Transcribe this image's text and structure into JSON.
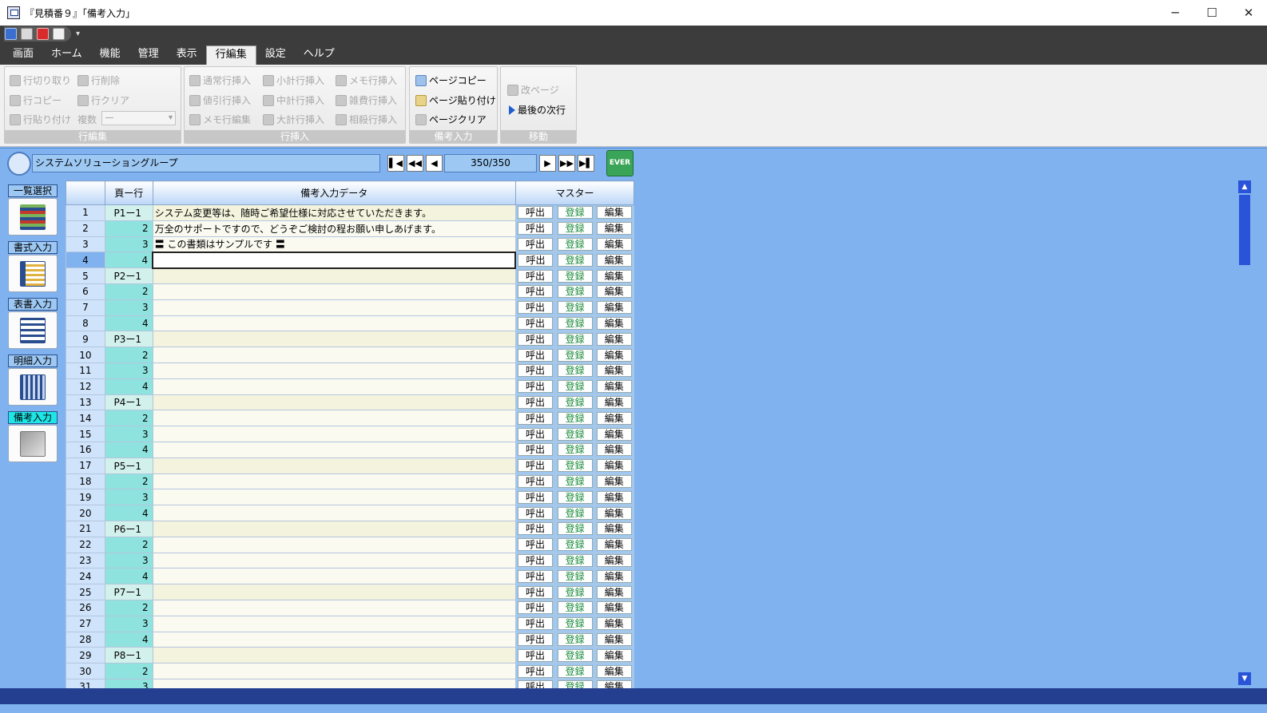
{
  "window": {
    "title": "『見積番９』「備考入力」",
    "minimize": "─",
    "maximize": "☐",
    "close": "✕"
  },
  "qat_more": "▾",
  "menu": [
    "画面",
    "ホーム",
    "機能",
    "管理",
    "表示",
    "行編集",
    "設定",
    "ヘルプ"
  ],
  "menu_active": "行編集",
  "ribbon": {
    "edit": {
      "label": "行編集",
      "cut": "行切り取り",
      "delete": "行削除",
      "copy": "行コピー",
      "clear": "行クリア",
      "paste": "行貼り付け",
      "multi": "複数",
      "multi_value": "ー"
    },
    "insert": {
      "label": "行挿入",
      "normal": "通常行挿入",
      "subtotal": "小計行挿入",
      "memo_insert": "メモ行挿入",
      "discount": "値引行挿入",
      "midtotal": "中計行挿入",
      "misc": "雑費行挿入",
      "memo_edit": "メモ行編集",
      "grandtotal": "大計行挿入",
      "offset": "相殺行挿入"
    },
    "remarks": {
      "label": "備考入力",
      "page_copy": "ページコピー",
      "page_paste": "ページ貼り付け",
      "page_clear": "ページクリア"
    },
    "move": {
      "label": "移動",
      "break": "改ページ",
      "last": "最後の次行"
    }
  },
  "navbar": {
    "group_name": "システムソリューショングループ",
    "first": "▌◀",
    "prev_fast": "◀◀",
    "prev": "◀",
    "page": "350/350",
    "next": "▶",
    "next_fast": "▶▶",
    "last": "▶▌",
    "ever": "EVER"
  },
  "sidebar": [
    "一覧選択",
    "書式入力",
    "表書入力",
    "明細入力",
    "備考入力"
  ],
  "sidebar_active": "備考入力",
  "grid": {
    "headers": {
      "no": "",
      "page": "頁ー行",
      "data": "備考入力データ",
      "master": "マスター"
    },
    "btn_call": "呼出",
    "btn_register": "登録",
    "btn_edit": "編集",
    "current_row": 4,
    "rows": [
      {
        "no": "1",
        "page": "P1ー1",
        "data": "システム変更等は、随時ご希望仕様に対応させていただきます。"
      },
      {
        "no": "2",
        "page": "2",
        "data": "万全のサポートですので、どうぞご検討の程お願い申しあげます。"
      },
      {
        "no": "3",
        "page": "3",
        "data": "〓 この書類はサンプルです 〓"
      },
      {
        "no": "4",
        "page": "4",
        "data": ""
      },
      {
        "no": "5",
        "page": "P2ー1",
        "data": ""
      },
      {
        "no": "6",
        "page": "2",
        "data": ""
      },
      {
        "no": "7",
        "page": "3",
        "data": ""
      },
      {
        "no": "8",
        "page": "4",
        "data": ""
      },
      {
        "no": "9",
        "page": "P3ー1",
        "data": ""
      },
      {
        "no": "10",
        "page": "2",
        "data": ""
      },
      {
        "no": "11",
        "page": "3",
        "data": ""
      },
      {
        "no": "12",
        "page": "4",
        "data": ""
      },
      {
        "no": "13",
        "page": "P4ー1",
        "data": ""
      },
      {
        "no": "14",
        "page": "2",
        "data": ""
      },
      {
        "no": "15",
        "page": "3",
        "data": ""
      },
      {
        "no": "16",
        "page": "4",
        "data": ""
      },
      {
        "no": "17",
        "page": "P5ー1",
        "data": ""
      },
      {
        "no": "18",
        "page": "2",
        "data": ""
      },
      {
        "no": "19",
        "page": "3",
        "data": ""
      },
      {
        "no": "20",
        "page": "4",
        "data": ""
      },
      {
        "no": "21",
        "page": "P6ー1",
        "data": ""
      },
      {
        "no": "22",
        "page": "2",
        "data": ""
      },
      {
        "no": "23",
        "page": "3",
        "data": ""
      },
      {
        "no": "24",
        "page": "4",
        "data": ""
      },
      {
        "no": "25",
        "page": "P7ー1",
        "data": ""
      },
      {
        "no": "26",
        "page": "2",
        "data": ""
      },
      {
        "no": "27",
        "page": "3",
        "data": ""
      },
      {
        "no": "28",
        "page": "4",
        "data": ""
      },
      {
        "no": "29",
        "page": "P8ー1",
        "data": ""
      },
      {
        "no": "30",
        "page": "2",
        "data": ""
      },
      {
        "no": "31",
        "page": "3",
        "data": ""
      }
    ]
  },
  "scroll": {
    "up": "▲",
    "down": "▼"
  }
}
